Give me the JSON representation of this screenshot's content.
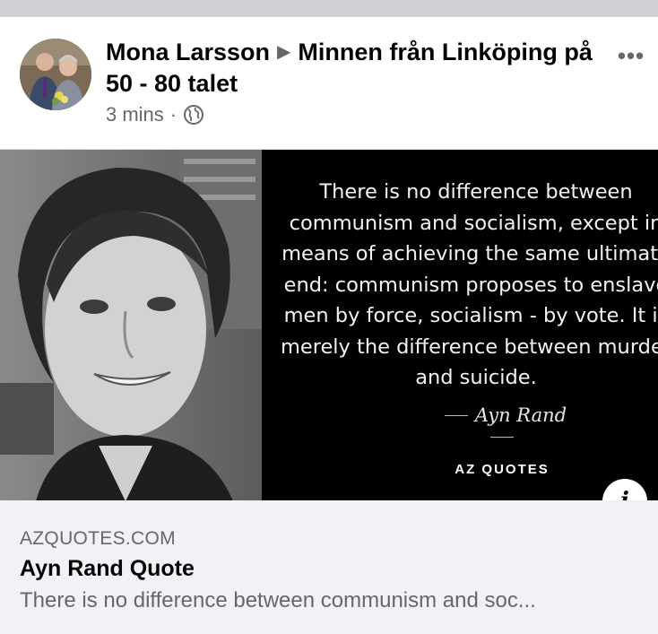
{
  "post": {
    "author": "Mona Larsson",
    "separator_icon": "triangle-right-icon",
    "group": "Minnen från Linköping på 50 - 80 talet",
    "time": "3 mins",
    "privacy_icon": "globe-icon",
    "more_label": "•••"
  },
  "link_card": {
    "quote_text": "There is no difference between\ncommunism and socialism, except in\nmeans of achieving the same ultimate\nend: communism proposes to enslave\nmen by force, socialism - by vote. It is\nmerely the difference between murder\nand suicide.",
    "quote_author": "Ayn Rand",
    "brand": "AZ QUOTES",
    "info_label": "i",
    "domain": "AZQUOTES.COM",
    "title": "Ayn Rand Quote",
    "description": "There is no difference between communism and soc..."
  },
  "colors": {
    "secondary_text": "#65676b",
    "meta_background": "#f0f2f5",
    "divider": "#ced0d4"
  }
}
